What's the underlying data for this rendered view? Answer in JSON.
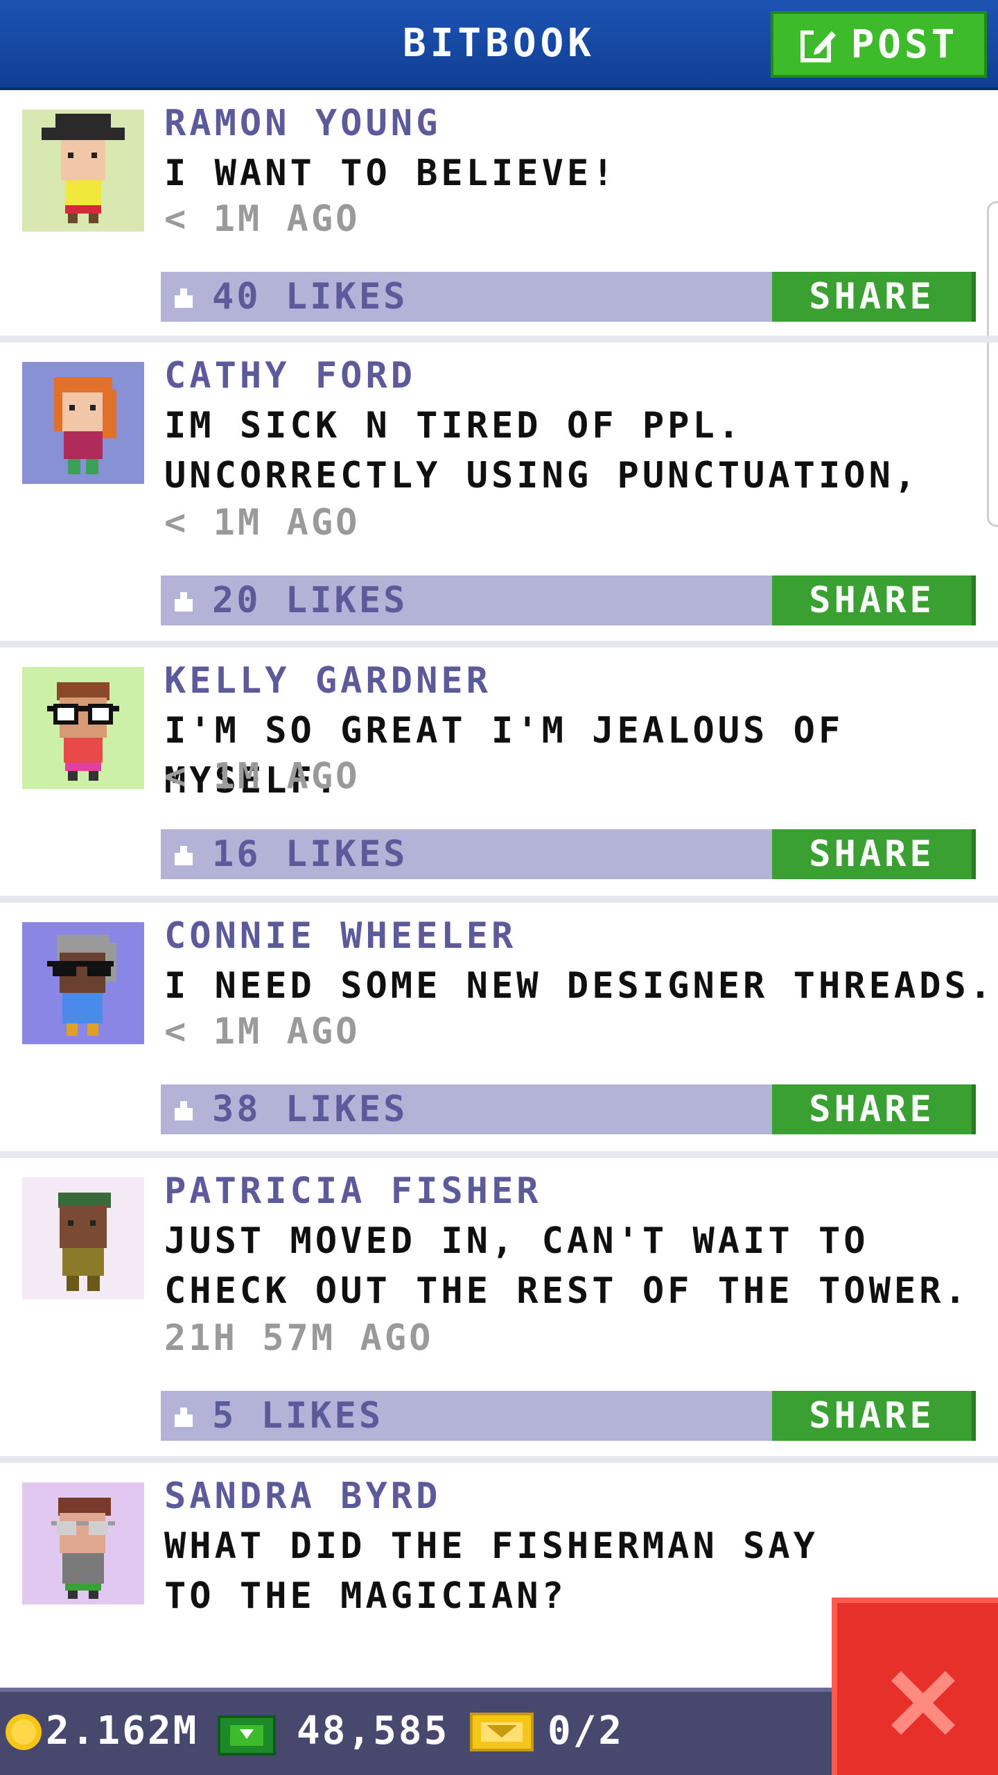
{
  "app": {
    "title": "BITBOOK",
    "post_label": "POST"
  },
  "colors": {
    "header": "#1d53b3",
    "post_button": "#3dbb2a",
    "like_bar": "#b3b3d8",
    "share_button": "#3aa032",
    "author_text": "#5c5a9a",
    "close_button": "#e8302a"
  },
  "posts": [
    {
      "author": "RAMON YOUNG",
      "message": "I WANT TO BELIEVE!",
      "time": "< 1M AGO",
      "likes": "40 LIKES",
      "share_label": "SHARE",
      "avatar_bg": "#d8e8b0"
    },
    {
      "author": "CATHY FORD",
      "message": "IM SICK N TIRED OF PPL. UNCORRECTLY USING PUNCTUATION,",
      "time": "< 1M AGO",
      "likes": "20 LIKES",
      "share_label": "SHARE",
      "avatar_bg": "#8890d6"
    },
    {
      "author": "KELLY GARDNER",
      "message": "I'M SO GREAT I'M JEALOUS OF MYSELF.",
      "time": "< 1M AGO",
      "likes": "16 LIKES",
      "share_label": "SHARE",
      "avatar_bg": "#ccf0a8"
    },
    {
      "author": "CONNIE WHEELER",
      "message": "I NEED SOME NEW DESIGNER THREADS.",
      "time": "< 1M AGO",
      "likes": "38 LIKES",
      "share_label": "SHARE",
      "avatar_bg": "#8a86e6"
    },
    {
      "author": "PATRICIA FISHER",
      "message": "JUST MOVED IN, CAN'T WAIT TO CHECK OUT THE REST OF THE TOWER.",
      "time": "21H 57M AGO",
      "likes": "5 LIKES",
      "share_label": "SHARE",
      "avatar_bg": "#f3eaf6"
    },
    {
      "author": "SANDRA BYRD",
      "message": "WHAT DID THE FISHERMAN SAY TO THE MAGICIAN?",
      "avatar_bg": "#e0c8f0"
    }
  ],
  "status": {
    "coins": "2.162M",
    "bux": "48,585",
    "tickets": "0/2"
  },
  "icons": [
    "edit-icon",
    "thumbs-up-icon",
    "coin-icon",
    "bux-icon",
    "ticket-icon",
    "close-icon"
  ]
}
